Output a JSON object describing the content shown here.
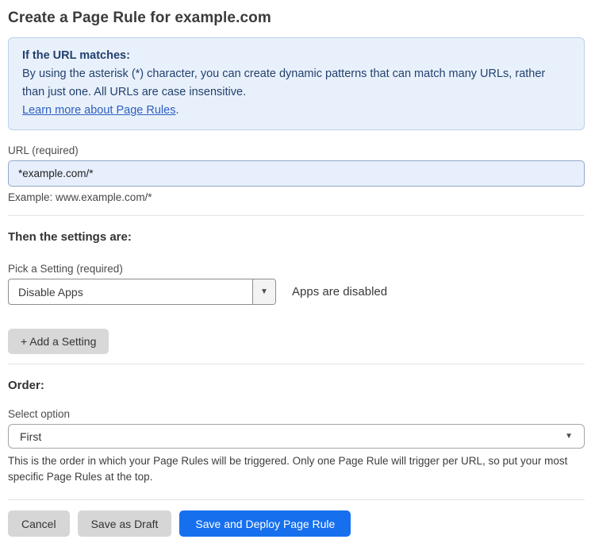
{
  "page": {
    "title": "Create a Page Rule for example.com"
  },
  "info_box": {
    "heading": "If the URL matches:",
    "body": "By using the asterisk (*) character, you can create dynamic patterns that can match many URLs, rather than just one. All URLs are case insensitive.",
    "link_label": "Learn more about Page Rules",
    "link_suffix": "."
  },
  "url_field": {
    "label": "URL (required)",
    "value": "*example.com/*",
    "helper": "Example: www.example.com/*"
  },
  "settings_section": {
    "heading": "Then the settings are:",
    "setting_label": "Pick a Setting (required)",
    "setting_value": "Disable Apps",
    "setting_status": "Apps are disabled",
    "add_setting_label": "+ Add a Setting"
  },
  "order_section": {
    "heading": "Order:",
    "select_label": "Select option",
    "selected_value": "First",
    "helper": "This is the order in which your Page Rules will be triggered. Only one Page Rule will trigger per URL, so put your most specific Page Rules at the top."
  },
  "footer": {
    "cancel_label": "Cancel",
    "save_draft_label": "Save as Draft",
    "deploy_label": "Save and Deploy Page Rule"
  },
  "icons": {
    "caret_down": "▼"
  },
  "colors": {
    "accent_blue": "#1670ee",
    "info_background": "#e8f1fb",
    "info_border": "#b9d1ee",
    "info_text": "#24406f",
    "link_blue": "#2e5dc0",
    "input_background": "#e7effc",
    "gray_button": "#d6d6d6"
  }
}
